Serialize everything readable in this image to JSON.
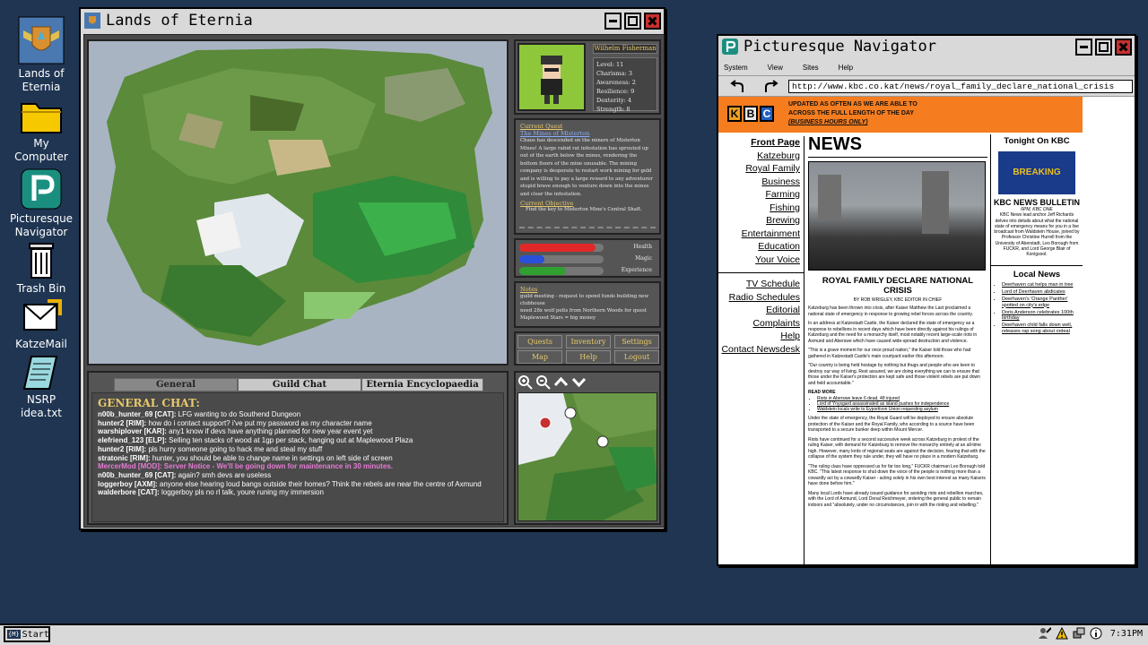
{
  "desktop": {
    "icons": [
      {
        "label": "Lands of Eternia",
        "icon": "eternia-shield-icon"
      },
      {
        "label": "My Computer",
        "icon": "folder-icon"
      },
      {
        "label": "Picturesque Navigator",
        "icon": "navigator-p-icon"
      },
      {
        "label": "Trash Bin",
        "icon": "trash-icon"
      },
      {
        "label": "KatzeMail",
        "icon": "mail-icon"
      },
      {
        "label": "NSRP idea.txt",
        "icon": "text-file-icon"
      }
    ]
  },
  "game": {
    "title": "Lands of Eternia",
    "character": {
      "name": "Wilhelm Fisherman",
      "stats": [
        "Level: 11",
        "Charisma: 3",
        "Awareness: 2",
        "Resilience: 9",
        "Dexterity: 4",
        "Strength: 8"
      ]
    },
    "quest": {
      "heading": "Current Quest",
      "name": "The Mines of Misterton",
      "text": "Chaos has descended on the miners of Misterton Mines! A large rabid rat infestation has sprouted up out of the earth below the mines, rendering the bottom floors of the mine unusable. The mining company is desperate to restart work mining for gold and is willing to pay a large reward to any adventurer stupid brave enough to venture down into the mines and clear the infestation.",
      "objective_heading": "Current Objective",
      "objective": "Find the key to Misterton Mine's Central Shaft."
    },
    "bars": [
      {
        "label": "Health",
        "value": 0.9,
        "color": "#e02828"
      },
      {
        "label": "Magic",
        "value": 0.3,
        "color": "#2850d8"
      },
      {
        "label": "Experience",
        "value": 0.55,
        "color": "#30a030"
      }
    ],
    "notes": {
      "heading": "Notes",
      "lines": [
        "guild meeting - request to spend funds building new clubhouse",
        "need 28x wolf pelts from Northern Woods for quest",
        "Maplewood Stars = big money"
      ]
    },
    "buttons": [
      "Quests",
      "Inventory",
      "Settings",
      "Map",
      "Help",
      "Logout"
    ],
    "tabs": [
      "General",
      "Guild Chat",
      "Eternia Encyclopaedia"
    ],
    "chat": {
      "heading": "GENERAL CHAT:",
      "lines": [
        {
          "user": "n00b_hunter_69 [CAT]:",
          "msg": "LFG wanting to do Southend Dungeon",
          "mod": false
        },
        {
          "user": "hunter2 [RIM]:",
          "msg": "how do i contact support? i've put my password as my character name",
          "mod": false
        },
        {
          "user": "warshiplover [KAR]:",
          "msg": "any1 know if devs have anything planned for new year event yet",
          "mod": false
        },
        {
          "user": "elefriend_123 [ELP]:",
          "msg": "Selling ten stacks of wood at 1gp per stack, hanging out at Maplewood Plaza",
          "mod": false
        },
        {
          "user": "hunter2 [RIM]:",
          "msg": "pls hurry someone going to hack me and steal my stuff",
          "mod": false
        },
        {
          "user": "stratonic [RIM]:",
          "msg": "hunter, you should be able to change name in settings on left side of screen",
          "mod": false
        },
        {
          "user": "MercerMod [MOD]:",
          "msg": "Server Notice - We'll be going down for maintenance in 30 minutes.",
          "mod": true
        },
        {
          "user": "n00b_hunter_69 [CAT]:",
          "msg": "again? smh devs are useless",
          "mod": false
        },
        {
          "user": "loggerboy [AXM]:",
          "msg": "anyone else hearing loud bangs outside their homes? Think the rebels are near the centre of Axmund",
          "mod": false
        },
        {
          "user": "walderbore [CAT]:",
          "msg": "loggerboy pls no rl talk, youre runing my immersion",
          "mod": false
        }
      ]
    }
  },
  "browser": {
    "title": "Picturesque Navigator",
    "menu": [
      "System",
      "View",
      "Sites",
      "Help"
    ],
    "url": "http://www.kbc.co.kat/news/royal_family_declare_national_crisis",
    "banner": {
      "logo": [
        "K",
        "B",
        "C"
      ],
      "line1": "UPDATED AS OFTEN AS WE ARE ABLE TO",
      "line2": "ACROSS THE FULL LENGTH OF THE DAY",
      "line3": "(BUSINESS HOURS ONLY)"
    },
    "nav": [
      "Front Page",
      "Katzeburg",
      "Royal Family",
      "Business",
      "Farming",
      "Fishing",
      "Brewing",
      "Entertainment",
      "Education",
      "Your Voice"
    ],
    "nav2": [
      "TV Schedule",
      "Radio Schedules",
      "Editorial Complaints",
      "Help",
      "Contact Newsdesk"
    ],
    "section": "NEWS",
    "headline": "ROYAL FAMILY DECLARE NATIONAL CRISIS",
    "byline": "BY ROB WRIGLEY, KBC EDITOR IN CHIEF",
    "paras": [
      "Katzeburg has been thrown into crisis, after Kaiser Matthew the Last proclaimed a national state of emergency in response to growing rebel forces across the country.",
      "In an address at Katzestadt Castle, the Kaiser declared the state of emergency as a response to rebellions in recent days which have been directly against his rulings of Katzeburg and the need for a monarchy itself, most notably recent large-scale riots in Axmund and Aberswe which have caused wide-spread destruction and violence.",
      "\"This is a grave moment for our once proud nation,\" the Kaiser told those who had gathered in Katzestadt Castle's main courtyard earlier this afternoon.",
      "\"Our country is being held hostage by nothing but thugs and people who are keen to destroy our way of living. Rest assured, we are doing everything we can to ensure that those under the Kaiser's protection are kept safe and those violent rebels are put down and held accountable.\""
    ],
    "read_more_heading": "READ MORE",
    "read_more": [
      "Riots in Aberswe leave 6 dead, 48 injured",
      "Lord of Ynysgard assassinated as island pushes for independence",
      "Waldstein locals write to Eyportivon Union requesting asylum"
    ],
    "paras2": [
      "Under the state of emergency, the Royal Guard will be deployed to ensure absolute protection of the Kaiser and the Royal Family, who according to a source have been transported to a secure bunker deep within Mount Mercer.",
      "Riots have continued for a second successive week across Katzeburg in protest of the ruling Kaiser, with demand for Katzeburg to remove the monarchy entirely at an all-time high. However, many lords of regional seats are against the decision, fearing that with the collapse of the system they rule under, they will have no place in a modern Katzeburg.",
      "\"The ruling class have oppressed us for far too long,\" FUCKR chairman Leo Borough told KBC. \"This latest response to shut down the voice of the people is nothing more than a cowardly act by a cowardly Kaiser - acting solely in his own best interest as many Kaisers have done before him.\"",
      "Many local Lords have already issued guidance for avoiding riots and rebellion marches, with the Lord of Axmund, Lord Donal Reichmeyer, ordering the general public to remain indoors and \"absolutely, under no circumstances, join in with the rioting and rebelling.\""
    ],
    "tonight": {
      "heading": "Tonight On KBC",
      "badge": "BREAKING",
      "show": "KBC NEWS BULLETIN",
      "time": "6PM, KBC ONE",
      "desc": "KBC News lead anchor Jeff Richards delves into details about what the national state of emergency means for you in a live broadcast from Waldstein House, joined by Professor Christine Hurrell from the University of Aberstadt, Leo Borough from FUCKR, and Lord George Blair of Konigsool."
    },
    "local": {
      "heading": "Local News",
      "items": [
        "Deerhaven cat helps man in tree",
        "Lord of Deerhaven abdicates",
        "Deerhaven's 'Orange Panther' spotted on city's edge",
        "Doris Anderson celebrates 100th birthday",
        "Deerhaven child falls down well, releases rap song about ordeal"
      ]
    }
  },
  "taskbar": {
    "start_label": "Start",
    "start_icon": "{M}",
    "clock": "7:31PM"
  }
}
